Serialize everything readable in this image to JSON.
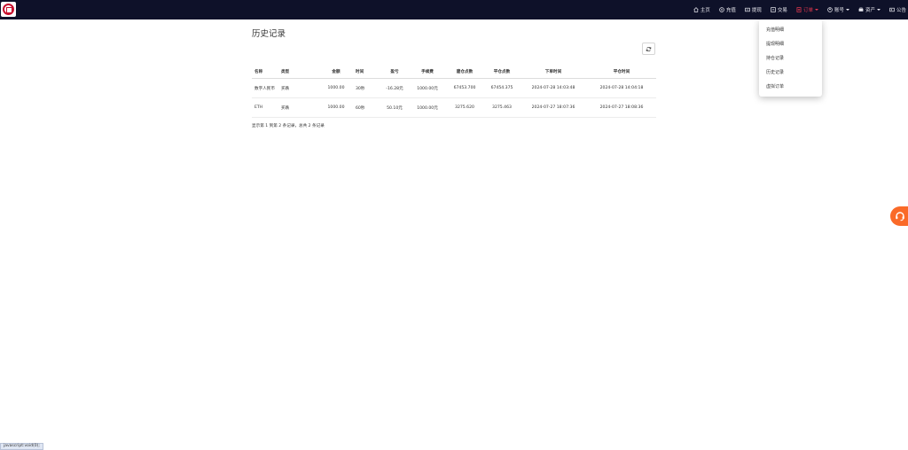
{
  "nav": {
    "home": "主页",
    "recharge": "充值",
    "withdraw": "提现",
    "trade": "交易",
    "orders": "订单",
    "account": "账号",
    "assets": "资产",
    "notice": "公告"
  },
  "dropdown": {
    "items": [
      "充值明细",
      "提现明细",
      "持仓记录",
      "历史记录",
      "虚拟订单"
    ]
  },
  "page": {
    "title": "历史记录"
  },
  "table": {
    "headers": [
      "名称",
      "类型",
      "金额",
      "时间",
      "盈亏",
      "手续费",
      "建仓点数",
      "平仓点数",
      "下单时间",
      "平仓时间"
    ],
    "rows": [
      [
        "数字人民币",
        "买跌",
        "1000.00",
        "30秒",
        "-16.28元",
        "1000.00元",
        "67453.700",
        "67454.375",
        "2024-07-28 14:03:48",
        "2024-07-28 14:04:18"
      ],
      [
        "ETH",
        "买跌",
        "1000.00",
        "60秒",
        "50.10元",
        "1000.00元",
        "3275.620",
        "3275.463",
        "2024-07-27 18:07:36",
        "2024-07-27 18:08:36"
      ]
    ]
  },
  "footer": {
    "summary": "显示第 1 到第 2 条记录，总共 2 条记录"
  },
  "status_bar": {
    "url": "javascript:void(0);"
  },
  "colors": {
    "topbar": "#0e1129",
    "active_nav": "#e8384f",
    "service_button": "#fa6a28"
  },
  "icons": [
    "home-icon",
    "recharge-icon",
    "withdraw-icon",
    "trade-icon",
    "orders-icon",
    "account-icon",
    "assets-icon",
    "notice-icon",
    "refresh-icon",
    "headset-icon"
  ]
}
